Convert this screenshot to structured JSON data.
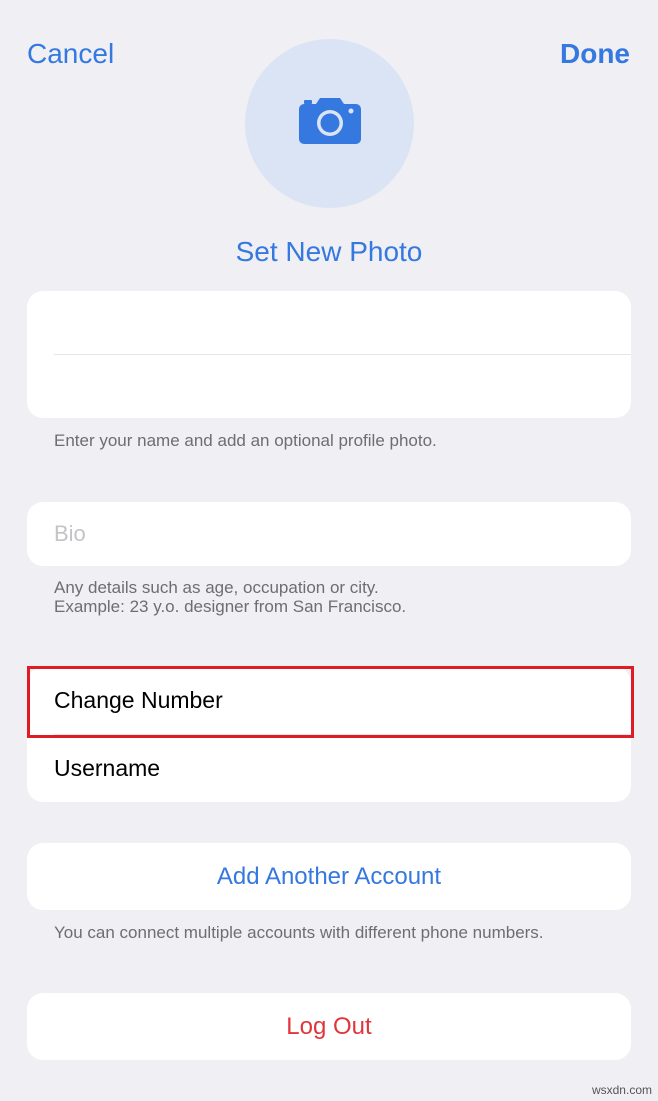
{
  "header": {
    "cancel_label": "Cancel",
    "done_label": "Done"
  },
  "photo": {
    "icon": "camera-icon",
    "set_label": "Set New Photo"
  },
  "name_section": {
    "first_name_value": "",
    "last_name_value": "",
    "hint": "Enter your name and add an optional profile photo."
  },
  "bio_section": {
    "placeholder": "Bio",
    "hint_line1": "Any details such as age, occupation or city.",
    "hint_line2": "Example: 23 y.o. designer from San Francisco."
  },
  "account_list": {
    "change_number_label": "Change Number",
    "username_label": "Username"
  },
  "add_account": {
    "label": "Add Another Account",
    "hint": "You can connect multiple accounts with different phone numbers."
  },
  "logout": {
    "label": "Log Out"
  },
  "watermark": "wsxdn.com",
  "colors": {
    "accent": "#3478e0",
    "destructive": "#e0363b",
    "highlight": "#e01b24",
    "background": "#efeff4"
  }
}
